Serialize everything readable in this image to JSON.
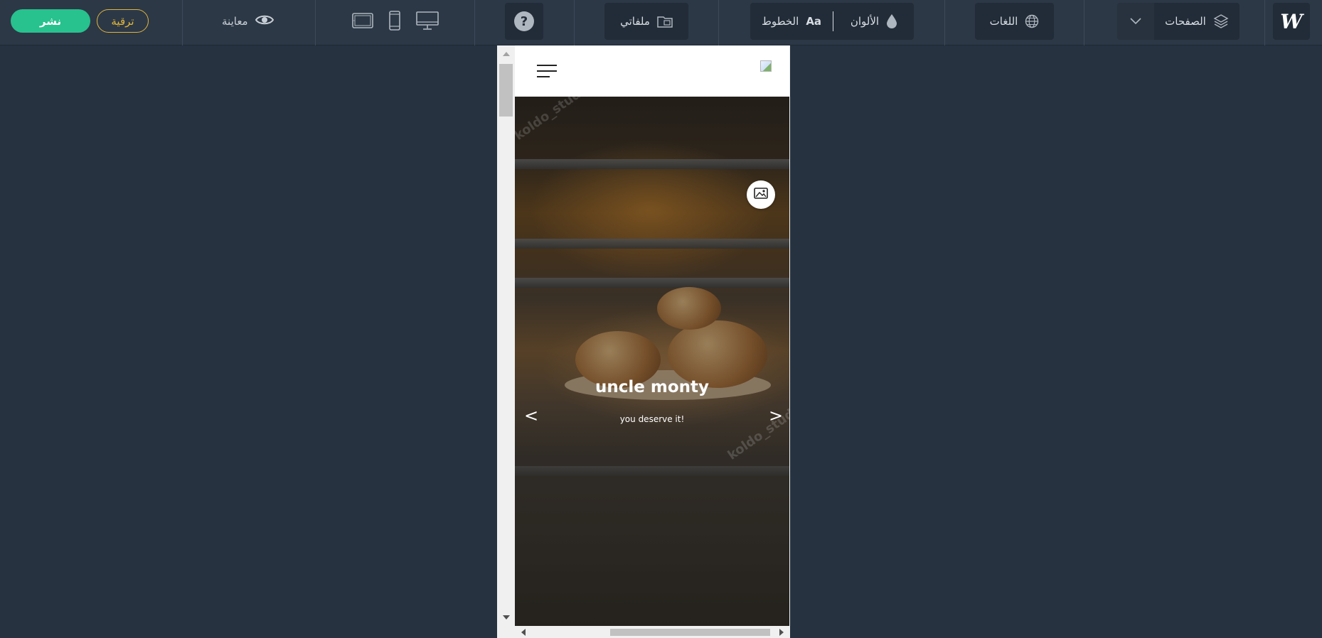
{
  "toolbar": {
    "publish_label": "نشر",
    "upgrade_label": "ترقية",
    "preview_label": "معاينة",
    "files_label": "ملفاتي",
    "fonts_label": "الخطوط",
    "fonts_icon_text": "Aa",
    "colors_label": "الألوان",
    "languages_label": "اللغات",
    "pages_label": "الصفحات",
    "help_glyph": "?",
    "logo_text": "W",
    "colors": {
      "publish": "#27c28e",
      "upgrade": "#e1b53a",
      "bar": "#2c3846",
      "canvas": "#263240"
    }
  },
  "site": {
    "hero": {
      "title": "uncle monty",
      "subtitle": "you deserve it!",
      "prev_glyph": "<",
      "next_glyph": ">",
      "watermark": "koldo_studio"
    }
  }
}
